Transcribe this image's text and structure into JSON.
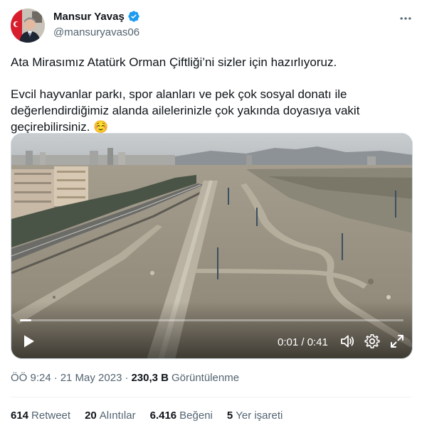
{
  "author": {
    "display_name": "Mansur Yavaş",
    "handle": "@mansuryavas06",
    "verified": true,
    "verified_color": "#1d9bf0"
  },
  "tweet": {
    "paragraph_1": "Ata Mirasımız Atatürk Orman Çiftliği’ni sizler için hazırlıyoruz.",
    "paragraph_2_line_1": "Evcil hayvanlar parkı, spor alanları ve pek çok sosyal donatı ile",
    "paragraph_2_line_2": "değerlendirdiğimiz alanda ailelerinizle çok yakında doyasıya vakit",
    "paragraph_2_line_3": "geçirebilirsiniz. ☺️"
  },
  "video": {
    "current_time": "0:01",
    "duration": "0:41",
    "time_display": "0:01 / 0:41",
    "progress_fraction": 0.03
  },
  "meta": {
    "time": "ÖÖ 9:24",
    "date": "21 May 2023",
    "separator": "·",
    "views_count": "230,3 B",
    "views_label": "Görüntülenme"
  },
  "stats": {
    "retweets_count": "614",
    "retweets_label": "Retweet",
    "quotes_count": "20",
    "quotes_label": "Alıntılar",
    "likes_count": "6.416",
    "likes_label": "Beğeni",
    "bookmarks_count": "5",
    "bookmarks_label": "Yer işareti"
  },
  "icons": {
    "more": "more-horizontal-icon",
    "verified": "verified-badge-icon",
    "play": "play-icon",
    "volume": "volume-icon",
    "settings": "gear-icon",
    "fullscreen": "fullscreen-icon"
  }
}
